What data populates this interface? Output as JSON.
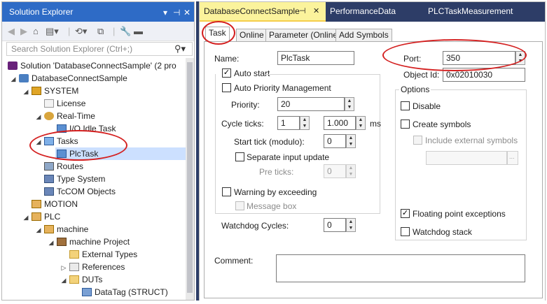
{
  "solution_explorer": {
    "title": "Solution Explorer",
    "search_placeholder": "Search Solution Explorer (Ctrl+;)",
    "tree": [
      {
        "label": "Solution 'DatabaseConnectSample' (2 pro",
        "icon": "solution-icon"
      },
      {
        "label": "DatabaseConnectSample",
        "icon": "project-icon"
      },
      {
        "label": "SYSTEM",
        "icon": "system-icon"
      },
      {
        "label": "License",
        "icon": "license-icon"
      },
      {
        "label": "Real-Time",
        "icon": "realtime-icon"
      },
      {
        "label": "I/O Idle Task",
        "icon": "io-idle-task-icon"
      },
      {
        "label": "Tasks",
        "icon": "tasks-icon"
      },
      {
        "label": "PlcTask",
        "icon": "plctask-icon"
      },
      {
        "label": "Routes",
        "icon": "routes-icon"
      },
      {
        "label": "Type System",
        "icon": "type-system-icon"
      },
      {
        "label": "TcCOM Objects",
        "icon": "tccom-icon"
      },
      {
        "label": "MOTION",
        "icon": "motion-icon"
      },
      {
        "label": "PLC",
        "icon": "plc-icon"
      },
      {
        "label": "machine",
        "icon": "plc-project-icon"
      },
      {
        "label": "machine Project",
        "icon": "plc-subproject-icon"
      },
      {
        "label": "External Types",
        "icon": "folder-icon"
      },
      {
        "label": "References",
        "icon": "references-icon"
      },
      {
        "label": "DUTs",
        "icon": "folder-icon"
      },
      {
        "label": "DataTag (STRUCT)",
        "icon": "struct-icon"
      }
    ]
  },
  "document": {
    "tabs": [
      {
        "label": "DatabaseConnectSample"
      },
      {
        "label": "PerformanceData"
      },
      {
        "label": "PLCTaskMeasurement"
      }
    ],
    "inner_tabs": [
      "Task",
      "Online",
      "Parameter (Online)",
      "Add Symbols"
    ],
    "form": {
      "name_label": "Name:",
      "name_value": "PlcTask",
      "auto_start_label": "Auto start",
      "auto_start_checked": true,
      "auto_priority_label": "Auto Priority Management",
      "priority_label": "Priority:",
      "priority_value": "20",
      "cycle_ticks_label": "Cycle ticks:",
      "cycle_ticks_value": "1",
      "cycle_time_value": "1.000",
      "cycle_unit": "ms",
      "start_tick_label": "Start tick (modulo):",
      "start_tick_value": "0",
      "separate_input_label": "Separate input update",
      "pre_ticks_label": "Pre ticks:",
      "pre_ticks_value": "0",
      "warning_label": "Warning by exceeding",
      "message_box_label": "Message box",
      "watchdog_label": "Watchdog Cycles:",
      "watchdog_value": "0",
      "port_label": "Port:",
      "port_value": "350",
      "object_id_label": "Object Id:",
      "object_id_value": "0x02010030",
      "options_label": "Options",
      "disable_label": "Disable",
      "create_symbols_label": "Create symbols",
      "include_external_label": "Include external symbols",
      "browse_label": "...",
      "floating_point_label": "Floating point exceptions",
      "floating_point_checked": true,
      "watchdog_stack_label": "Watchdog stack",
      "comment_label": "Comment:"
    }
  },
  "colors": {
    "title_bar": "#2e6bc6",
    "doc_tab_bar": "#2d3d67",
    "active_tab": "#fbf39c",
    "selection": "#cce0ff",
    "annotation_red": "#d42020"
  }
}
